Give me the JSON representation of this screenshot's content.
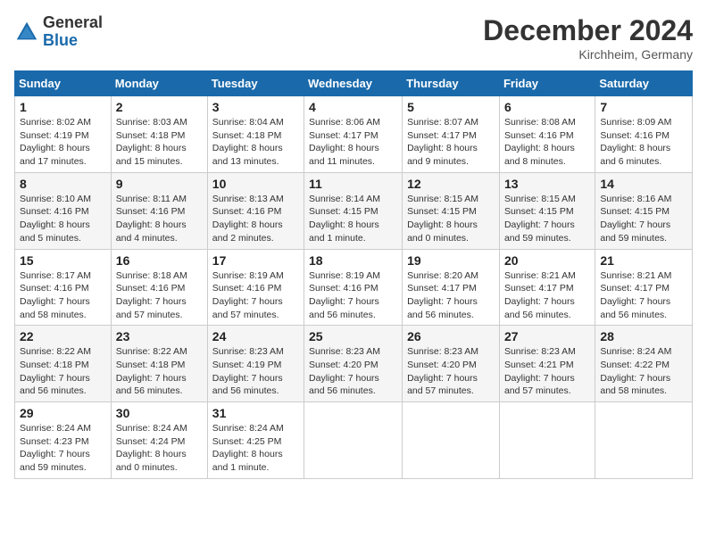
{
  "header": {
    "logo_general": "General",
    "logo_blue": "Blue",
    "month_title": "December 2024",
    "location": "Kirchheim, Germany"
  },
  "weekdays": [
    "Sunday",
    "Monday",
    "Tuesday",
    "Wednesday",
    "Thursday",
    "Friday",
    "Saturday"
  ],
  "weeks": [
    [
      {
        "day": "1",
        "sunrise": "8:02 AM",
        "sunset": "4:19 PM",
        "daylight": "8 hours and 17 minutes."
      },
      {
        "day": "2",
        "sunrise": "8:03 AM",
        "sunset": "4:18 PM",
        "daylight": "8 hours and 15 minutes."
      },
      {
        "day": "3",
        "sunrise": "8:04 AM",
        "sunset": "4:18 PM",
        "daylight": "8 hours and 13 minutes."
      },
      {
        "day": "4",
        "sunrise": "8:06 AM",
        "sunset": "4:17 PM",
        "daylight": "8 hours and 11 minutes."
      },
      {
        "day": "5",
        "sunrise": "8:07 AM",
        "sunset": "4:17 PM",
        "daylight": "8 hours and 9 minutes."
      },
      {
        "day": "6",
        "sunrise": "8:08 AM",
        "sunset": "4:16 PM",
        "daylight": "8 hours and 8 minutes."
      },
      {
        "day": "7",
        "sunrise": "8:09 AM",
        "sunset": "4:16 PM",
        "daylight": "8 hours and 6 minutes."
      }
    ],
    [
      {
        "day": "8",
        "sunrise": "8:10 AM",
        "sunset": "4:16 PM",
        "daylight": "8 hours and 5 minutes."
      },
      {
        "day": "9",
        "sunrise": "8:11 AM",
        "sunset": "4:16 PM",
        "daylight": "8 hours and 4 minutes."
      },
      {
        "day": "10",
        "sunrise": "8:13 AM",
        "sunset": "4:16 PM",
        "daylight": "8 hours and 2 minutes."
      },
      {
        "day": "11",
        "sunrise": "8:14 AM",
        "sunset": "4:15 PM",
        "daylight": "8 hours and 1 minute."
      },
      {
        "day": "12",
        "sunrise": "8:15 AM",
        "sunset": "4:15 PM",
        "daylight": "8 hours and 0 minutes."
      },
      {
        "day": "13",
        "sunrise": "8:15 AM",
        "sunset": "4:15 PM",
        "daylight": "7 hours and 59 minutes."
      },
      {
        "day": "14",
        "sunrise": "8:16 AM",
        "sunset": "4:15 PM",
        "daylight": "7 hours and 59 minutes."
      }
    ],
    [
      {
        "day": "15",
        "sunrise": "8:17 AM",
        "sunset": "4:16 PM",
        "daylight": "7 hours and 58 minutes."
      },
      {
        "day": "16",
        "sunrise": "8:18 AM",
        "sunset": "4:16 PM",
        "daylight": "7 hours and 57 minutes."
      },
      {
        "day": "17",
        "sunrise": "8:19 AM",
        "sunset": "4:16 PM",
        "daylight": "7 hours and 57 minutes."
      },
      {
        "day": "18",
        "sunrise": "8:19 AM",
        "sunset": "4:16 PM",
        "daylight": "7 hours and 56 minutes."
      },
      {
        "day": "19",
        "sunrise": "8:20 AM",
        "sunset": "4:17 PM",
        "daylight": "7 hours and 56 minutes."
      },
      {
        "day": "20",
        "sunrise": "8:21 AM",
        "sunset": "4:17 PM",
        "daylight": "7 hours and 56 minutes."
      },
      {
        "day": "21",
        "sunrise": "8:21 AM",
        "sunset": "4:17 PM",
        "daylight": "7 hours and 56 minutes."
      }
    ],
    [
      {
        "day": "22",
        "sunrise": "8:22 AM",
        "sunset": "4:18 PM",
        "daylight": "7 hours and 56 minutes."
      },
      {
        "day": "23",
        "sunrise": "8:22 AM",
        "sunset": "4:18 PM",
        "daylight": "7 hours and 56 minutes."
      },
      {
        "day": "24",
        "sunrise": "8:23 AM",
        "sunset": "4:19 PM",
        "daylight": "7 hours and 56 minutes."
      },
      {
        "day": "25",
        "sunrise": "8:23 AM",
        "sunset": "4:20 PM",
        "daylight": "7 hours and 56 minutes."
      },
      {
        "day": "26",
        "sunrise": "8:23 AM",
        "sunset": "4:20 PM",
        "daylight": "7 hours and 57 minutes."
      },
      {
        "day": "27",
        "sunrise": "8:23 AM",
        "sunset": "4:21 PM",
        "daylight": "7 hours and 57 minutes."
      },
      {
        "day": "28",
        "sunrise": "8:24 AM",
        "sunset": "4:22 PM",
        "daylight": "7 hours and 58 minutes."
      }
    ],
    [
      {
        "day": "29",
        "sunrise": "8:24 AM",
        "sunset": "4:23 PM",
        "daylight": "7 hours and 59 minutes."
      },
      {
        "day": "30",
        "sunrise": "8:24 AM",
        "sunset": "4:24 PM",
        "daylight": "8 hours and 0 minutes."
      },
      {
        "day": "31",
        "sunrise": "8:24 AM",
        "sunset": "4:25 PM",
        "daylight": "8 hours and 1 minute."
      },
      null,
      null,
      null,
      null
    ]
  ]
}
